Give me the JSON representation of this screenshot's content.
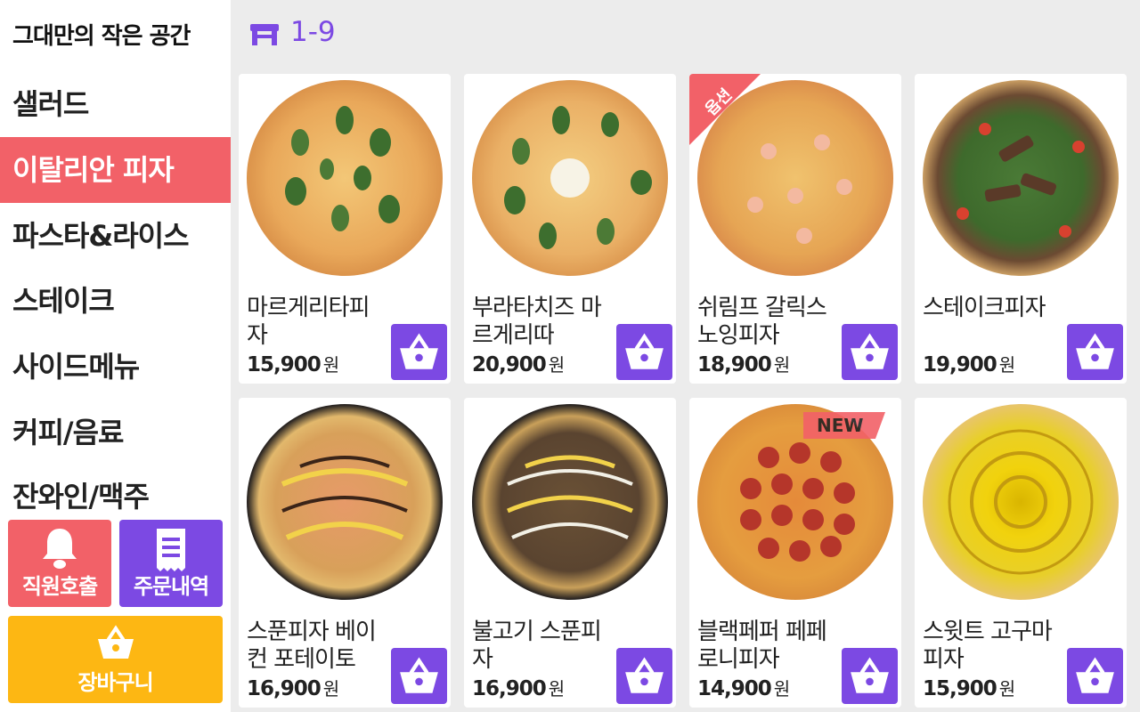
{
  "sidebar": {
    "store_name": "그대만의 작은 공간",
    "categories": [
      {
        "label": "샐러드",
        "active": false
      },
      {
        "label": "이탈리안 피자",
        "active": true
      },
      {
        "label": "파스타&라이스",
        "active": false
      },
      {
        "label": "스테이크",
        "active": false
      },
      {
        "label": "사이드메뉴",
        "active": false
      },
      {
        "label": "커피/음료",
        "active": false
      },
      {
        "label": "잔와인/맥주",
        "active": false
      }
    ],
    "staff_call_label": "직원호출",
    "order_history_label": "주문내역",
    "cart_label": "장바구니"
  },
  "header": {
    "table_icon": "table-icon",
    "table_number": "1-9"
  },
  "colors": {
    "accent_red": "#f26168",
    "accent_purple": "#7c49e3",
    "accent_yellow": "#fdb713"
  },
  "products": [
    {
      "name": "마르게리타피자",
      "price": "15,900",
      "currency": "원",
      "badge": ""
    },
    {
      "name": "부라타치즈 마르게리따",
      "price": "20,900",
      "currency": "원",
      "badge": ""
    },
    {
      "name": "쉬림프 갈릭스노잉피자",
      "price": "18,900",
      "currency": "원",
      "badge": "옵션"
    },
    {
      "name": "스테이크피자",
      "price": "19,900",
      "currency": "원",
      "badge": ""
    },
    {
      "name": "스푼피자 베이컨 포테이토",
      "price": "16,900",
      "currency": "원",
      "badge": ""
    },
    {
      "name": "불고기 스푼피자",
      "price": "16,900",
      "currency": "원",
      "badge": ""
    },
    {
      "name": "블랙페퍼 페페로니피자",
      "price": "14,900",
      "currency": "원",
      "badge": "NEW"
    },
    {
      "name": "스윗트 고구마 피자",
      "price": "15,900",
      "currency": "원",
      "badge": ""
    }
  ]
}
